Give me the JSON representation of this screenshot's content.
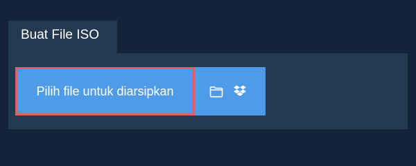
{
  "tab": {
    "label": "Buat File ISO"
  },
  "upload": {
    "choose_label": "Pilih file untuk diarsipkan",
    "icons": [
      "folder-icon",
      "dropbox-icon"
    ]
  },
  "colors": {
    "background": "#13243a",
    "panel": "#233950",
    "button": "#4f9be8",
    "highlight_border": "#e06060"
  }
}
